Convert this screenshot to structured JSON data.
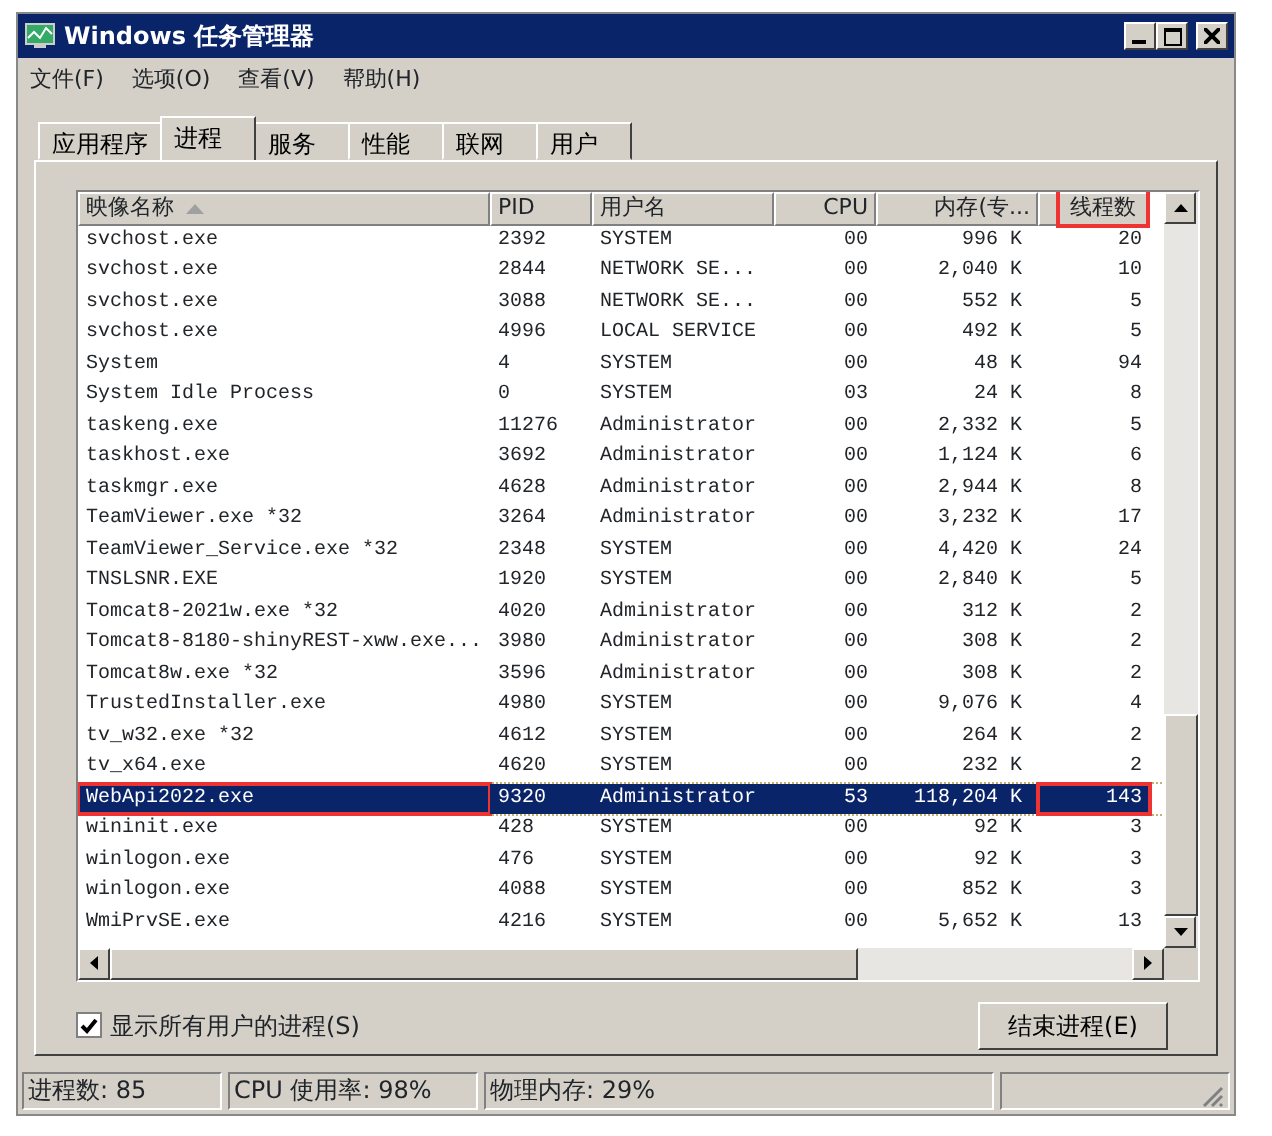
{
  "window": {
    "title": "Windows 任务管理器"
  },
  "menu": [
    "文件(F)",
    "选项(O)",
    "查看(V)",
    "帮助(H)"
  ],
  "tabs": [
    {
      "label": "应用程序",
      "selected": false
    },
    {
      "label": "进程",
      "selected": true
    },
    {
      "label": "服务",
      "selected": false
    },
    {
      "label": "性能",
      "selected": false
    },
    {
      "label": "联网",
      "selected": false
    },
    {
      "label": "用户",
      "selected": false
    }
  ],
  "table": {
    "columns": [
      {
        "label": "映像名称",
        "sorted": true,
        "highlighted": false
      },
      {
        "label": "PID",
        "sorted": false,
        "highlighted": false
      },
      {
        "label": "用户名",
        "sorted": false,
        "highlighted": false
      },
      {
        "label": "CPU",
        "sorted": false,
        "highlighted": false
      },
      {
        "label": "内存(专...",
        "sorted": false,
        "highlighted": false
      },
      {
        "label": "线程数",
        "sorted": false,
        "highlighted": true
      }
    ],
    "rows": [
      {
        "cells": [
          "svchost.exe",
          "2392",
          "SYSTEM",
          "00",
          "996 K",
          "20"
        ],
        "selected": false,
        "highlighted": false
      },
      {
        "cells": [
          "svchost.exe",
          "2844",
          "NETWORK SE...",
          "00",
          "2,040 K",
          "10"
        ],
        "selected": false,
        "highlighted": false
      },
      {
        "cells": [
          "svchost.exe",
          "3088",
          "NETWORK SE...",
          "00",
          "552 K",
          "5"
        ],
        "selected": false,
        "highlighted": false
      },
      {
        "cells": [
          "svchost.exe",
          "4996",
          "LOCAL SERVICE",
          "00",
          "492 K",
          "5"
        ],
        "selected": false,
        "highlighted": false
      },
      {
        "cells": [
          "System",
          "4",
          "SYSTEM",
          "00",
          "48 K",
          "94"
        ],
        "selected": false,
        "highlighted": false
      },
      {
        "cells": [
          "System Idle Process",
          "0",
          "SYSTEM",
          "03",
          "24 K",
          "8"
        ],
        "selected": false,
        "highlighted": false
      },
      {
        "cells": [
          "taskeng.exe",
          "11276",
          "Administrator",
          "00",
          "2,332 K",
          "5"
        ],
        "selected": false,
        "highlighted": false
      },
      {
        "cells": [
          "taskhost.exe",
          "3692",
          "Administrator",
          "00",
          "1,124 K",
          "6"
        ],
        "selected": false,
        "highlighted": false
      },
      {
        "cells": [
          "taskmgr.exe",
          "4628",
          "Administrator",
          "00",
          "2,944 K",
          "8"
        ],
        "selected": false,
        "highlighted": false
      },
      {
        "cells": [
          "TeamViewer.exe *32",
          "3264",
          "Administrator",
          "00",
          "3,232 K",
          "17"
        ],
        "selected": false,
        "highlighted": false
      },
      {
        "cells": [
          "TeamViewer_Service.exe *32",
          "2348",
          "SYSTEM",
          "00",
          "4,420 K",
          "24"
        ],
        "selected": false,
        "highlighted": false
      },
      {
        "cells": [
          "TNSLSNR.EXE",
          "1920",
          "SYSTEM",
          "00",
          "2,840 K",
          "5"
        ],
        "selected": false,
        "highlighted": false
      },
      {
        "cells": [
          "Tomcat8-2021w.exe *32",
          "4020",
          "Administrator",
          "00",
          "312 K",
          "2"
        ],
        "selected": false,
        "highlighted": false
      },
      {
        "cells": [
          "Tomcat8-8180-shinyREST-xww.exe...",
          "3980",
          "Administrator",
          "00",
          "308 K",
          "2"
        ],
        "selected": false,
        "highlighted": false
      },
      {
        "cells": [
          "Tomcat8w.exe *32",
          "3596",
          "Administrator",
          "00",
          "308 K",
          "2"
        ],
        "selected": false,
        "highlighted": false
      },
      {
        "cells": [
          "TrustedInstaller.exe",
          "4980",
          "SYSTEM",
          "00",
          "9,076 K",
          "4"
        ],
        "selected": false,
        "highlighted": false
      },
      {
        "cells": [
          "tv_w32.exe *32",
          "4612",
          "SYSTEM",
          "00",
          "264 K",
          "2"
        ],
        "selected": false,
        "highlighted": false
      },
      {
        "cells": [
          "tv_x64.exe",
          "4620",
          "SYSTEM",
          "00",
          "232 K",
          "2"
        ],
        "selected": false,
        "highlighted": false
      },
      {
        "cells": [
          "WebApi2022.exe",
          "9320",
          "Administrator",
          "53",
          "118,204 K",
          "143"
        ],
        "selected": true,
        "highlighted": true
      },
      {
        "cells": [
          "wininit.exe",
          "428",
          "SYSTEM",
          "00",
          "92 K",
          "3"
        ],
        "selected": false,
        "highlighted": false
      },
      {
        "cells": [
          "winlogon.exe",
          "476",
          "SYSTEM",
          "00",
          "92 K",
          "3"
        ],
        "selected": false,
        "highlighted": false
      },
      {
        "cells": [
          "winlogon.exe",
          "4088",
          "SYSTEM",
          "00",
          "852 K",
          "3"
        ],
        "selected": false,
        "highlighted": false
      },
      {
        "cells": [
          "WmiPrvSE.exe",
          "4216",
          "SYSTEM",
          "00",
          "5,652 K",
          "13"
        ],
        "selected": false,
        "highlighted": false
      }
    ]
  },
  "show_all_users": {
    "label": "显示所有用户的进程(S)",
    "checked": true
  },
  "end_process_button": "结束进程(E)",
  "status_bar": [
    "进程数: 85",
    "CPU 使用率: 98%",
    "物理内存: 29%"
  ]
}
